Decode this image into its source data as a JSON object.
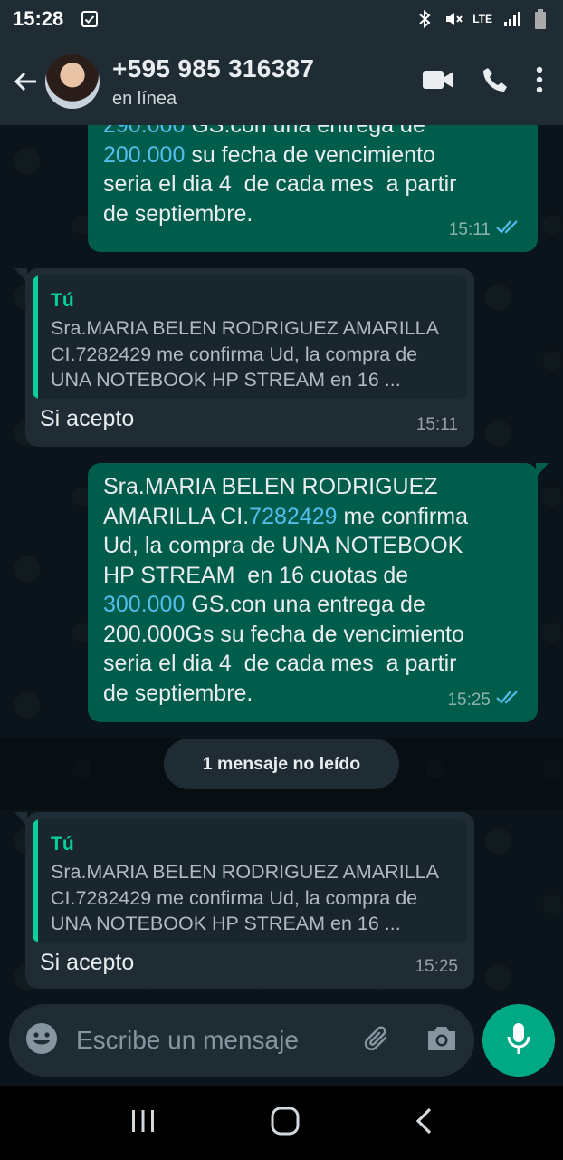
{
  "status_bar": {
    "time": "15:28",
    "network_label": "LTE"
  },
  "header": {
    "contact_name": "+595 985 316387",
    "contact_status": "en línea"
  },
  "messages": [
    {
      "direction": "outgoing",
      "text_parts": [
        {
          "text": "290.000",
          "link": true
        },
        {
          "text": " GS.con una entrega de\n",
          "link": false
        },
        {
          "text": "200.000",
          "link": true
        },
        {
          "text": " su fecha de vencimiento\nseria el dia 4  de cada mes  a partir\nde septiembre.",
          "link": false
        }
      ],
      "time": "15:11",
      "ticks": "read"
    },
    {
      "direction": "incoming",
      "quote_author": "Tú",
      "quote_text": "Sra.MARIA BELEN RODRIGUEZ AMARILLA CI.7282429 me confirma Ud, la compra de UNA NOTEBOOK HP STREAM  en 16 ...",
      "text": "Si acepto",
      "time": "15:11"
    },
    {
      "direction": "outgoing",
      "text_parts": [
        {
          "text": "Sra.MARIA BELEN RODRIGUEZ\nAMARILLA CI.",
          "link": false
        },
        {
          "text": "7282429",
          "link": true
        },
        {
          "text": " me confirma\nUd, la compra de UNA NOTEBOOK\nHP STREAM  en 16 cuotas de\n",
          "link": false
        },
        {
          "text": "300.000",
          "link": true
        },
        {
          "text": " GS.con una entrega de\n200.000Gs su fecha de vencimiento\nseria el dia 4  de cada mes  a partir\nde septiembre.",
          "link": false
        }
      ],
      "time": "15:25",
      "ticks": "read"
    },
    {
      "direction": "incoming",
      "quote_author": "Tú",
      "quote_text": "Sra.MARIA BELEN RODRIGUEZ AMARILLA CI.7282429 me confirma Ud, la compra de UNA NOTEBOOK HP STREAM  en 16 ...",
      "text": "Si acepto",
      "time": "15:25"
    }
  ],
  "unread_banner": "1 mensaje no leído",
  "composer": {
    "placeholder": "Escribe un mensaje"
  },
  "colors": {
    "outgoing_bubble": "#005c4b",
    "incoming_bubble": "#1f2c34",
    "accent": "#00a884",
    "link": "#53bdeb",
    "read_ticks": "#53bdeb"
  }
}
